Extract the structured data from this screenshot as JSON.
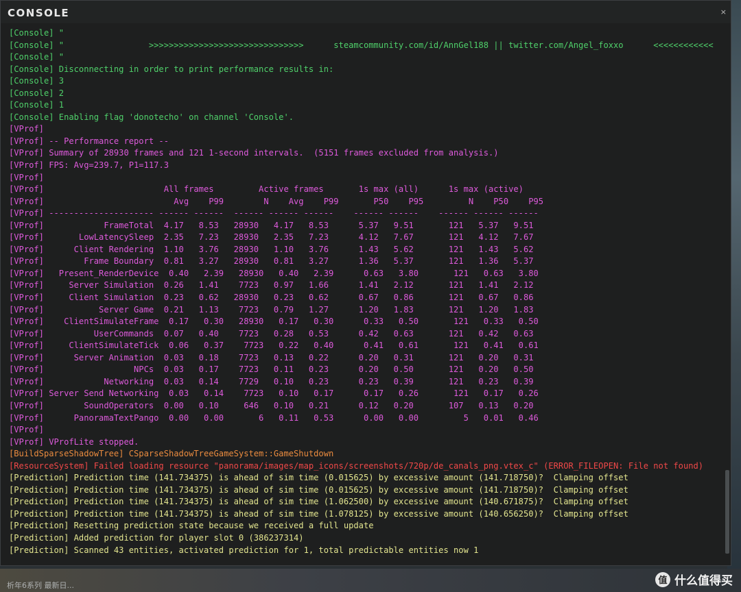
{
  "window": {
    "title": "CONSOLE",
    "close_glyph": "×"
  },
  "background": {
    "bottom_text": "析年6系列  最新日..."
  },
  "watermark": {
    "icon_glyph": "值",
    "text": "什么值得买"
  },
  "colors": {
    "console": "#4fd06a",
    "vprof": "#dd5adb",
    "build": "#ea8b3f",
    "error": "#f04848",
    "prediction": "#e3e58f"
  },
  "log_lines": [
    {
      "type": "console",
      "text": "[Console] \""
    },
    {
      "type": "console",
      "text": "[Console] \"                 >>>>>>>>>>>>>>>>>>>>>>>>>>>>>>>      steamcommunity.com/id/AnnGel188 || twitter.com/Angel_foxxo      <<<<<<<<<<<<"
    },
    {
      "type": "console",
      "text": "[Console] \""
    },
    {
      "type": "console",
      "text": "[Console] Disconnecting in order to print performance results in:"
    },
    {
      "type": "console",
      "text": "[Console] 3"
    },
    {
      "type": "console",
      "text": "[Console] 2"
    },
    {
      "type": "console",
      "text": "[Console] 1"
    },
    {
      "type": "console",
      "text": "[Console] Enabling flag 'donotecho' on channel 'Console'."
    },
    {
      "type": "vprof",
      "text": "[VProf]"
    },
    {
      "type": "vprof",
      "text": "[VProf] -- Performance report --"
    },
    {
      "type": "vprof",
      "text": "[VProf] Summary of 28930 frames and 121 1-second intervals.  (5151 frames excluded from analysis.)"
    },
    {
      "type": "vprof",
      "text": "[VProf] FPS: Avg=239.7, P1=117.3"
    },
    {
      "type": "vprof",
      "text": "[VProf]"
    },
    {
      "type": "vprof",
      "text": "[VProf]                        All frames         Active frames       1s max (all)      1s max (active)"
    },
    {
      "type": "vprof",
      "text": "[VProf]                          Avg    P99        N    Avg    P99       P50    P95         N    P50    P95"
    },
    {
      "type": "vprof",
      "text": "[VProf] --------------------- ------ ------  ------ ------ ------    ------ ------    ------ ------ ------"
    },
    {
      "type": "vprof",
      "text": "[VProf]            FrameTotal  4.17   8.53   28930   4.17   8.53      5.37   9.51       121   5.37   9.51"
    },
    {
      "type": "vprof",
      "text": "[VProf]       LowLatencySleep  2.35   7.23   28930   2.35   7.23      4.12   7.67       121   4.12   7.67"
    },
    {
      "type": "vprof",
      "text": "[VProf]      Client Rendering  1.10   3.76   28930   1.10   3.76      1.43   5.62       121   1.43   5.62"
    },
    {
      "type": "vprof",
      "text": "[VProf]        Frame Boundary  0.81   3.27   28930   0.81   3.27      1.36   5.37       121   1.36   5.37"
    },
    {
      "type": "vprof",
      "text": "[VProf]   Present_RenderDevice  0.40   2.39   28930   0.40   2.39      0.63   3.80       121   0.63   3.80"
    },
    {
      "type": "vprof",
      "text": "[VProf]     Server Simulation  0.26   1.41    7723   0.97   1.66      1.41   2.12       121   1.41   2.12"
    },
    {
      "type": "vprof",
      "text": "[VProf]     Client Simulation  0.23   0.62   28930   0.23   0.62      0.67   0.86       121   0.67   0.86"
    },
    {
      "type": "vprof",
      "text": "[VProf]           Server Game  0.21   1.13    7723   0.79   1.27      1.20   1.83       121   1.20   1.83"
    },
    {
      "type": "vprof",
      "text": "[VProf]    ClientSimulateFrame  0.17   0.30   28930   0.17   0.30      0.33   0.50       121   0.33   0.50"
    },
    {
      "type": "vprof",
      "text": "[VProf]          UserCommands  0.07   0.40    7723   0.28   0.53      0.42   0.63       121   0.42   0.63"
    },
    {
      "type": "vprof",
      "text": "[VProf]     ClientSimulateTick  0.06   0.37    7723   0.22   0.40      0.41   0.61       121   0.41   0.61"
    },
    {
      "type": "vprof",
      "text": "[VProf]      Server Animation  0.03   0.18    7723   0.13   0.22      0.20   0.31       121   0.20   0.31"
    },
    {
      "type": "vprof",
      "text": "[VProf]                  NPCs  0.03   0.17    7723   0.11   0.23      0.20   0.50       121   0.20   0.50"
    },
    {
      "type": "vprof",
      "text": "[VProf]            Networking  0.03   0.14    7729   0.10   0.23      0.23   0.39       121   0.23   0.39"
    },
    {
      "type": "vprof",
      "text": "[VProf] Server Send Networking  0.03   0.14    7723   0.10   0.17      0.17   0.26       121   0.17   0.26"
    },
    {
      "type": "vprof",
      "text": "[VProf]        SoundOperators  0.00   0.10     646   0.10   0.21      0.12   0.20       107   0.13   0.20"
    },
    {
      "type": "vprof",
      "text": "[VProf]      PanoramaTextPango  0.00   0.00       6   0.11   0.53      0.00   0.00         5   0.01   0.46"
    },
    {
      "type": "vprof",
      "text": "[VProf]"
    },
    {
      "type": "vprof",
      "text": "[VProf] VProfLite stopped."
    },
    {
      "type": "build",
      "text": "[BuildSparseShadowTree] CSparseShadowTreeGameSystem::GameShutdown"
    },
    {
      "type": "error",
      "text": "[ResourceSystem] Failed loading resource \"panorama/images/map_icons/screenshots/720p/de_canals_png.vtex_c\" (ERROR_FILEOPEN: File not found)"
    },
    {
      "type": "pred",
      "text": "[Prediction] Prediction time (141.734375) is ahead of sim time (0.015625) by excessive amount (141.718750)?  Clamping offset"
    },
    {
      "type": "pred",
      "text": "[Prediction] Prediction time (141.734375) is ahead of sim time (0.015625) by excessive amount (141.718750)?  Clamping offset"
    },
    {
      "type": "pred",
      "text": "[Prediction] Prediction time (141.734375) is ahead of sim time (1.062500) by excessive amount (140.671875)?  Clamping offset"
    },
    {
      "type": "pred",
      "text": "[Prediction] Prediction time (141.734375) is ahead of sim time (1.078125) by excessive amount (140.656250)?  Clamping offset"
    },
    {
      "type": "pred",
      "text": "[Prediction] Resetting prediction state because we received a full update"
    },
    {
      "type": "pred",
      "text": "[Prediction] Added prediction for player slot 0 (386237314)"
    },
    {
      "type": "pred",
      "text": "[Prediction] Scanned 43 entities, activated prediction for 1, total predictable entities now 1"
    }
  ]
}
